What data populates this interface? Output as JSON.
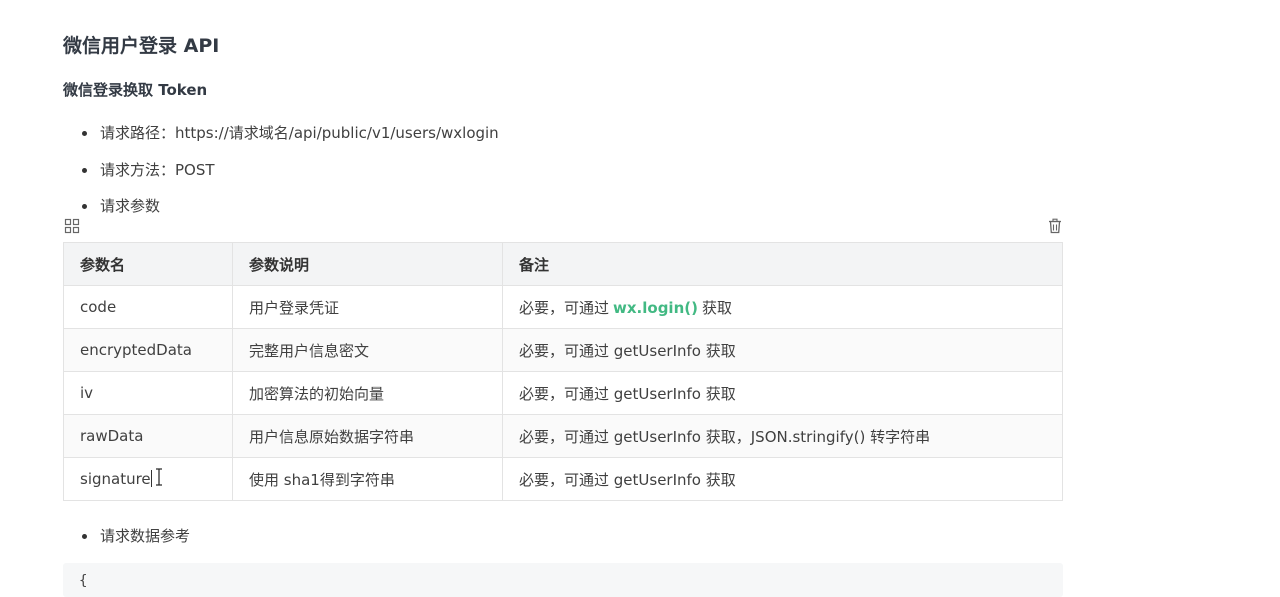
{
  "page": {
    "title": "微信用户登录 API",
    "section_title": "微信登录换取 Token"
  },
  "bullets": {
    "path": "请求路径：https://请求域名/api/public/v1/users/wxlogin",
    "method": "请求方法：POST",
    "params": "请求参数",
    "reference": "请求数据参考"
  },
  "table": {
    "headers": [
      "参数名",
      "参数说明",
      "备注"
    ],
    "rows": [
      {
        "name": "code",
        "desc": "用户登录凭证",
        "note_prefix": "必要，可通过",
        "note_code": "wx.login()",
        "note_suffix": "获取"
      },
      {
        "name": "encryptedData",
        "desc": "完整用户信息密文",
        "note": "必要，可通过 getUserInfo 获取"
      },
      {
        "name": "iv",
        "desc": "加密算法的初始向量",
        "note": "必要，可通过 getUserInfo 获取"
      },
      {
        "name": "rawData",
        "desc": "用户信息原始数据字符串",
        "note": "必要，可通过 getUserInfo 获取，JSON.stringify() 转字符串"
      },
      {
        "name": "signature",
        "desc": "使用 sha1得到字符串",
        "note": "必要，可通过 getUserInfo 获取"
      }
    ]
  },
  "code_block": {
    "first_line": "{"
  },
  "icons": {
    "table_grid": "grid-icon",
    "table_delete": "trash-icon",
    "cursor": "text-cursor-icon"
  },
  "colors": {
    "inline_code": "#42b983",
    "header_bg": "#f3f4f5",
    "border": "#e3e3e3"
  }
}
